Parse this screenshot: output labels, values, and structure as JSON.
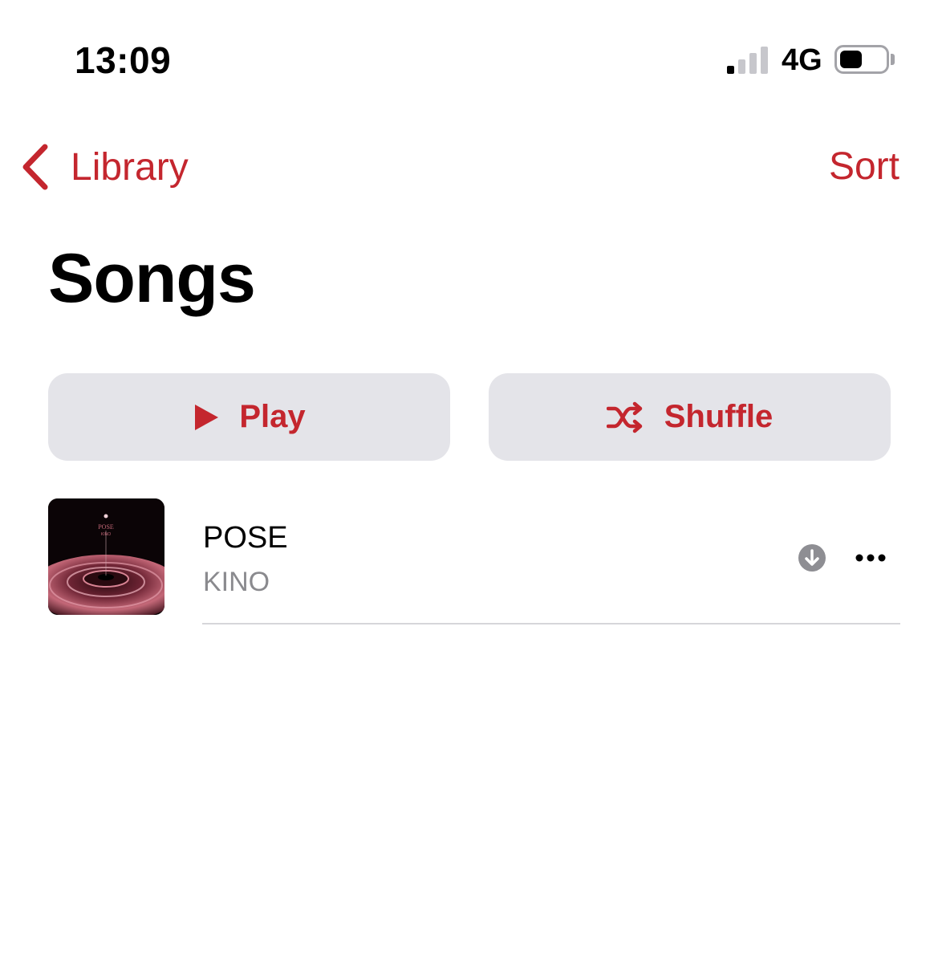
{
  "status_bar": {
    "time": "13:09",
    "network": "4G",
    "signal_bars_filled": 1,
    "signal_bars_total": 4,
    "battery_level": 0.5
  },
  "nav": {
    "back_label": "Library",
    "sort_label": "Sort"
  },
  "page": {
    "title": "Songs"
  },
  "actions": {
    "play_label": "Play",
    "shuffle_label": "Shuffle"
  },
  "songs": [
    {
      "title": "POSE",
      "artist": "KINO",
      "artwork_text": "POSE",
      "artwork_subtext": "KINO"
    }
  ],
  "theme": {
    "accent": "#c4262e",
    "button_bg": "#e4e4e9",
    "secondary_text": "#8a8a8e"
  },
  "icons": {
    "back": "chevron-left-icon",
    "play": "play-icon",
    "shuffle": "shuffle-icon",
    "download": "download-icon",
    "more": "ellipsis-icon"
  }
}
